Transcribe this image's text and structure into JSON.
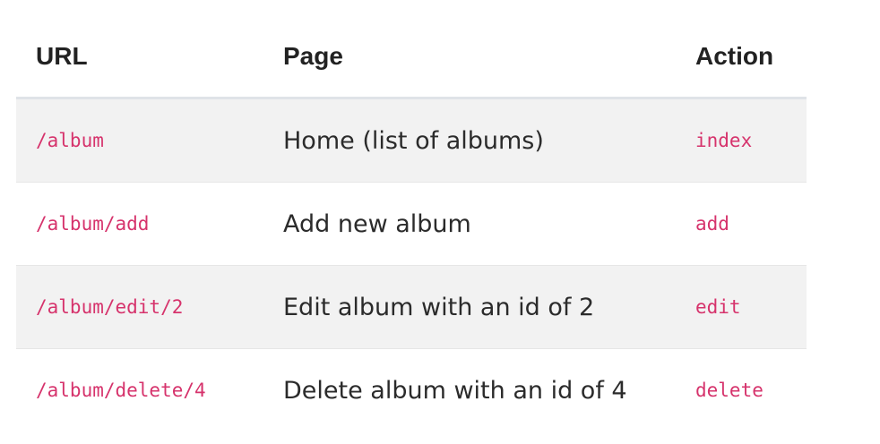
{
  "table": {
    "headers": {
      "url": "URL",
      "page": "Page",
      "action": "Action"
    },
    "rows": [
      {
        "url": "/album",
        "page": "Home (list of albums)",
        "action": "index"
      },
      {
        "url": "/album/add",
        "page": "Add new album",
        "action": "add"
      },
      {
        "url": "/album/edit/2",
        "page": "Edit album with an id of 2",
        "action": "edit"
      },
      {
        "url": "/album/delete/4",
        "page": "Delete album with an id of 4",
        "action": "delete"
      }
    ]
  },
  "colors": {
    "code_text": "#d6336c",
    "striped_row": "#f2f2f2",
    "header_text": "#222222"
  }
}
